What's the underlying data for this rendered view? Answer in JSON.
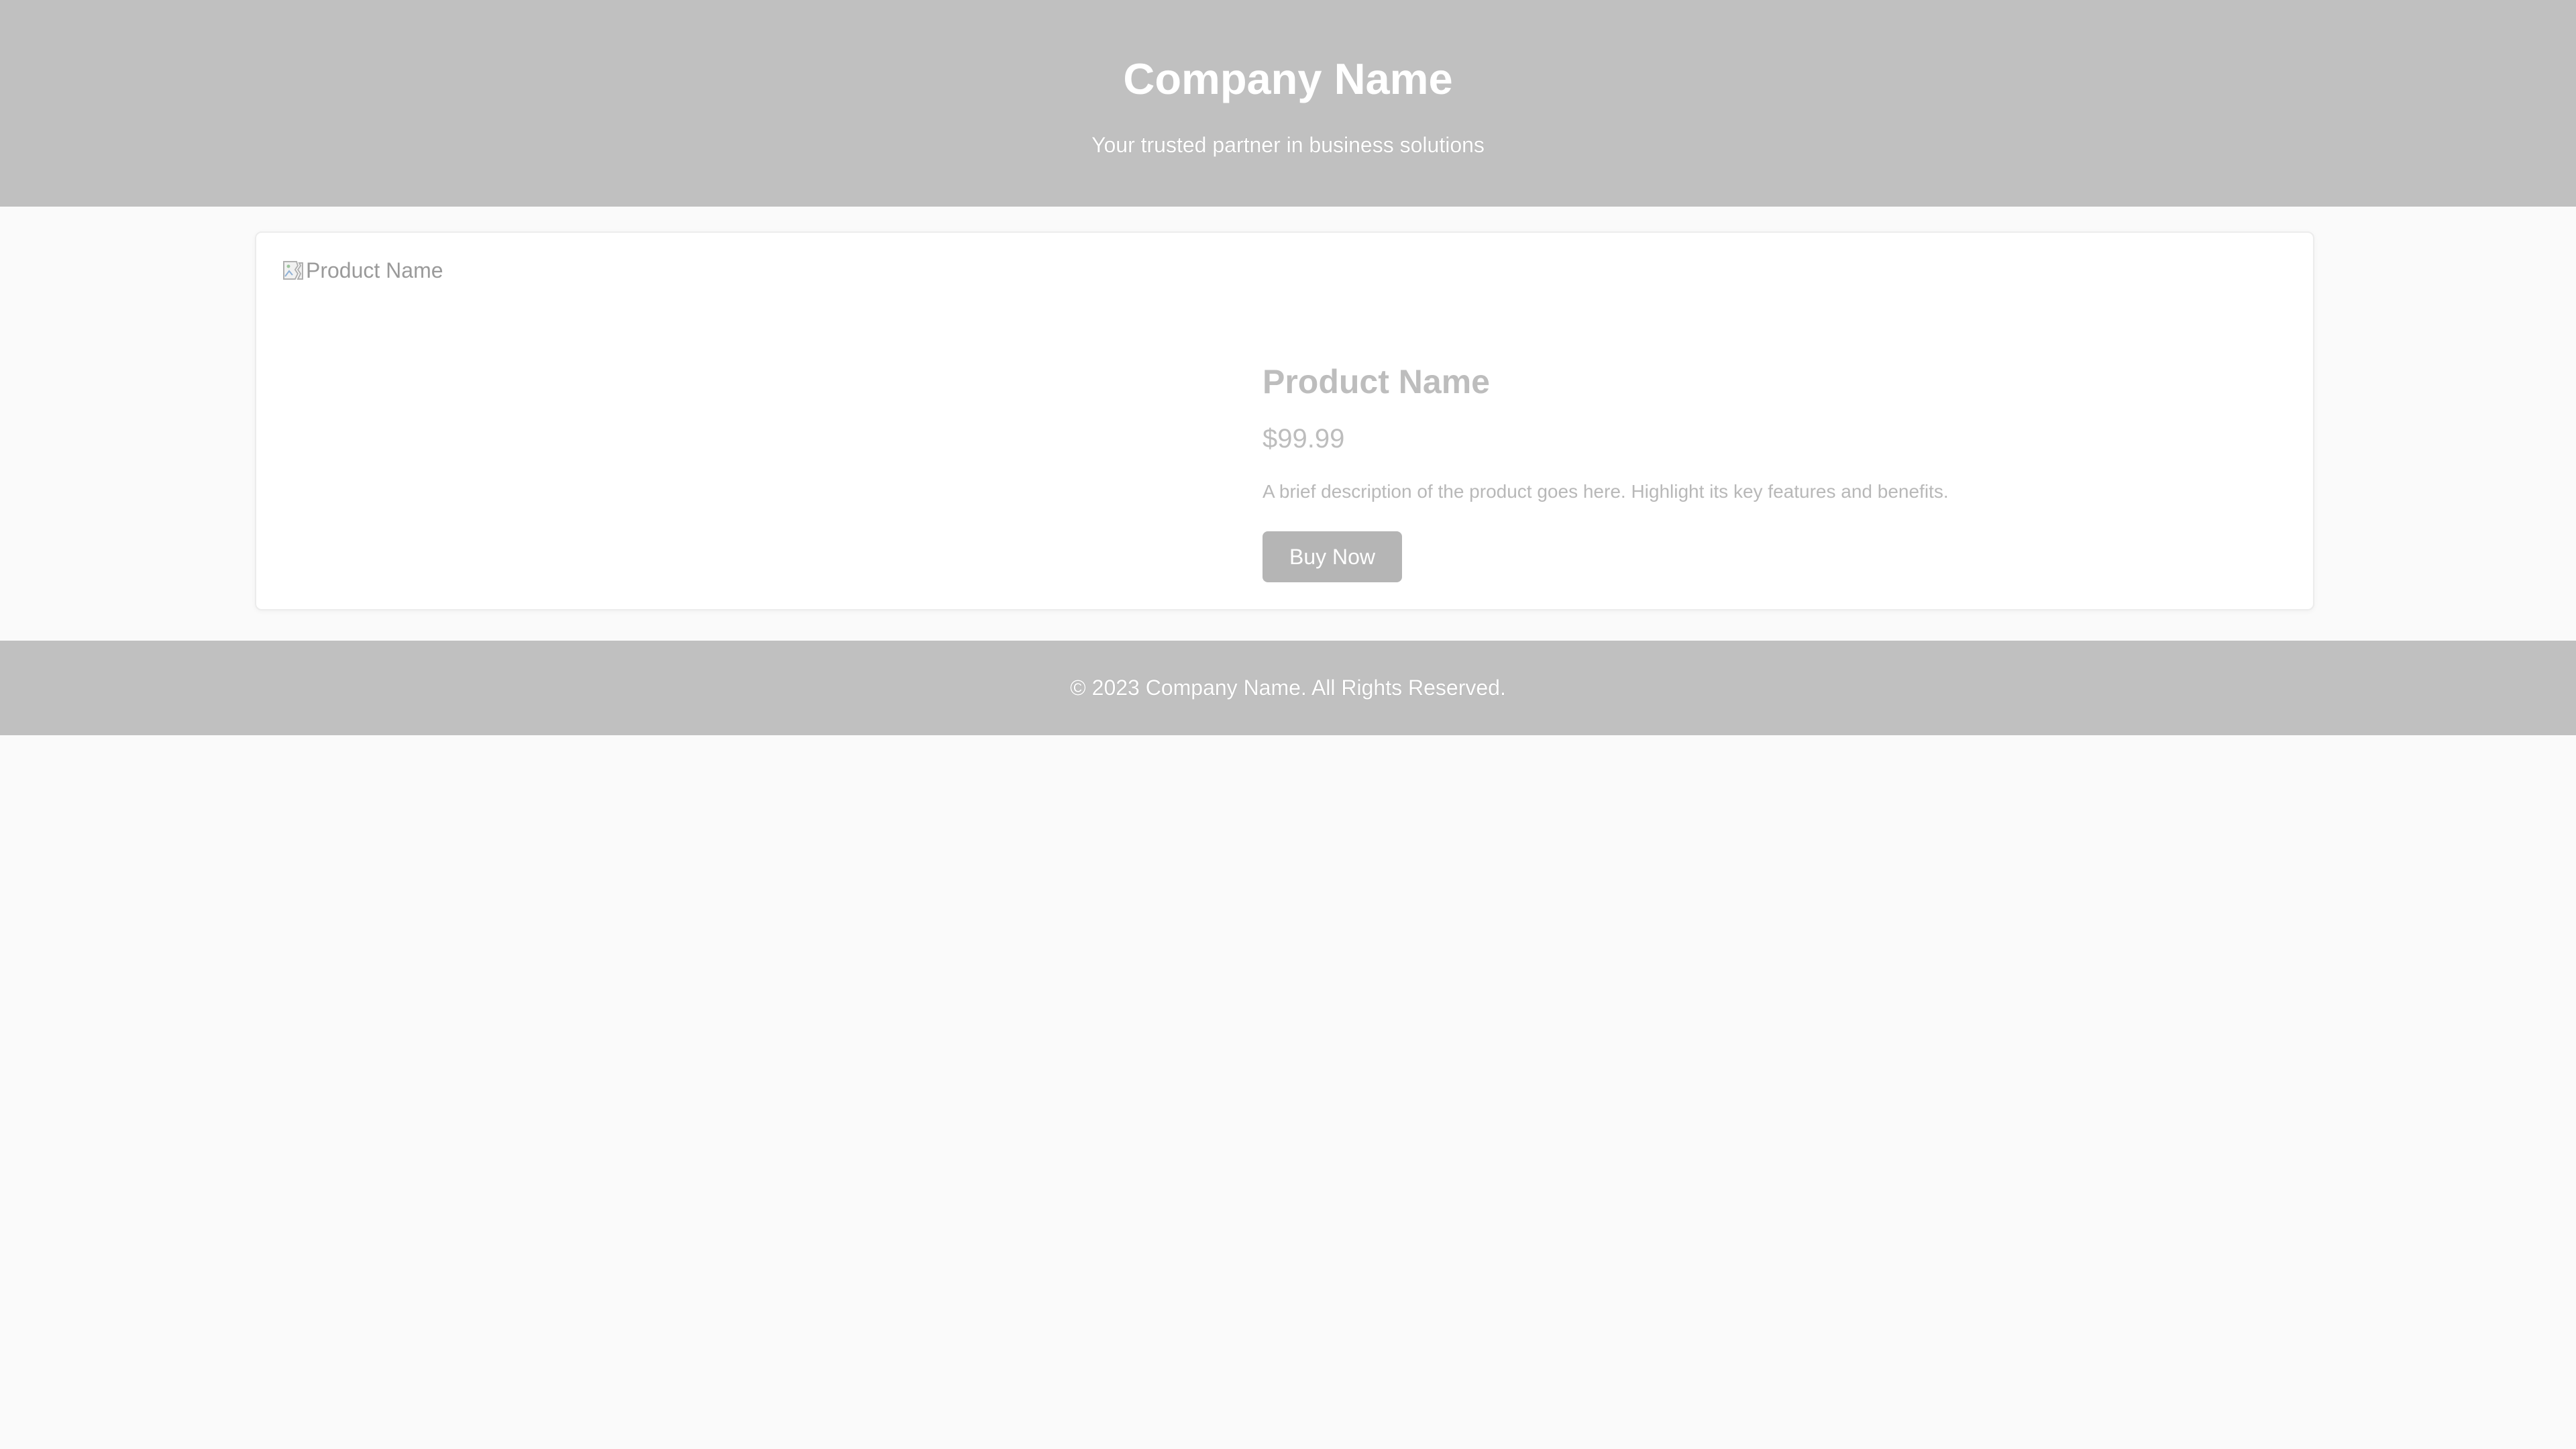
{
  "header": {
    "title": "Company Name",
    "tagline": "Your trusted partner in business solutions"
  },
  "product": {
    "image_alt": "Product Name",
    "image_icon": "broken-image-icon",
    "name": "Product Name",
    "price": "$99.99",
    "description": "A brief description of the product goes here. Highlight its key features and benefits.",
    "buy_label": "Buy Now"
  },
  "footer": {
    "copyright": "© 2023 Company Name. All Rights Reserved."
  },
  "colors": {
    "header_bg": "#c0c0c0",
    "page_bg": "#fafafa",
    "button_bg": "#b5b5b5"
  }
}
